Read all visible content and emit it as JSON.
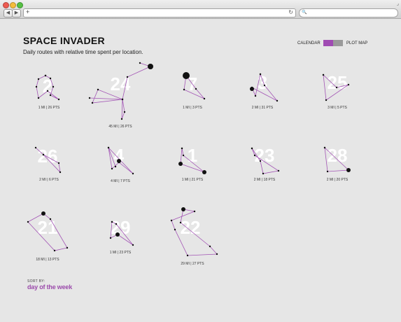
{
  "browser": {
    "back_glyph": "◀",
    "forward_glyph": "▶",
    "new_tab_glyph": "+",
    "reload_glyph": "↻",
    "search_glyph": "🔍",
    "resize_glyph": "⌟"
  },
  "page": {
    "title": "SPACE INVADER",
    "subtitle": "Daily routes with relative time spent per location.",
    "toggle": {
      "left_label": "CALENDAR",
      "right_label": "PLOT MAP",
      "active": "calendar",
      "active_color": "#a04bb3",
      "inactive_color": "#9a9a9a"
    },
    "sort": {
      "label": "SORT BY:",
      "value": "day of the week"
    }
  },
  "colors": {
    "route": "#a355b5",
    "point": "#111111"
  },
  "days": [
    {
      "day": "2",
      "stat": "1 MI | 26 PTS"
    },
    {
      "day": "24",
      "stat": "45 MI | 26 PTS"
    },
    {
      "day": "7",
      "stat": "1 MI | 3 PTS"
    },
    {
      "day": "3",
      "stat": "2 MI | 31 PTS"
    },
    {
      "day": "25",
      "stat": "3 MI | 5 PTS"
    },
    {
      "day": "26",
      "stat": "2 MI | 6 PTS"
    },
    {
      "day": "4",
      "stat": "4 MI | 7 PTS"
    },
    {
      "day": "1",
      "stat": "1 MI | 21 PTS"
    },
    {
      "day": "23",
      "stat": "2 MI | 18 PTS"
    },
    {
      "day": "28",
      "stat": "2 MI | 20 PTS"
    },
    {
      "day": "21",
      "stat": "18 MI | 13 PTS"
    },
    {
      "day": "29",
      "stat": "1 MI | 23 PTS"
    },
    {
      "day": "22",
      "stat": "29 MI | 27 PTS"
    }
  ]
}
